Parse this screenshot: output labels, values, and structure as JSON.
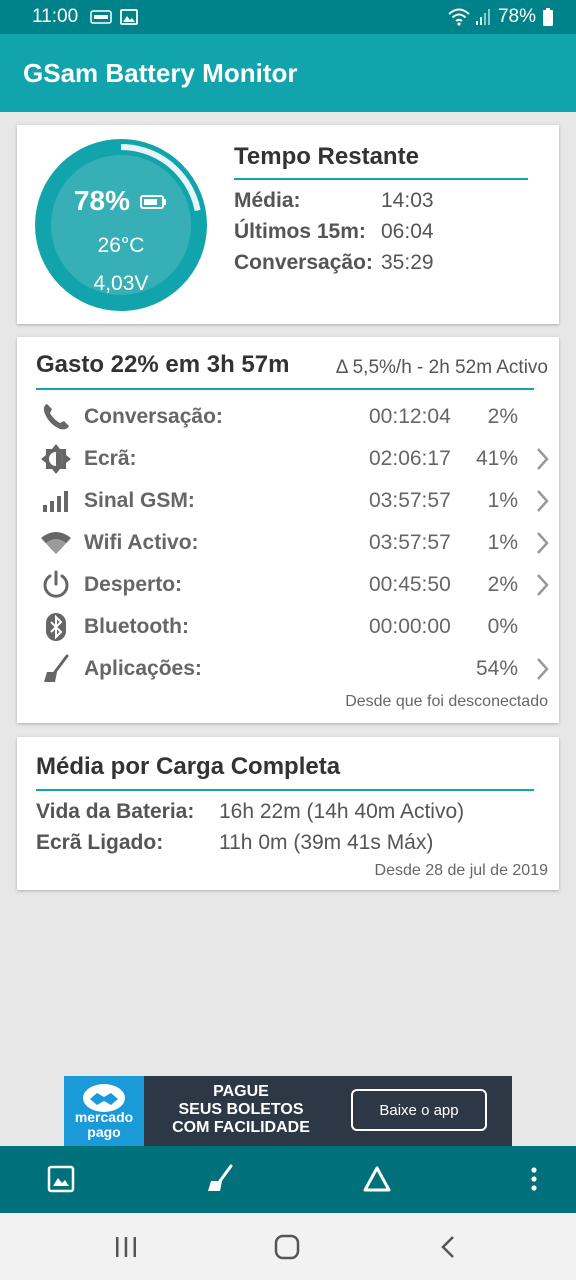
{
  "status_bar": {
    "time": "11:00",
    "battery": "78%"
  },
  "app_bar": {
    "title": "GSam Battery Monitor"
  },
  "battery_card": {
    "percent": "78%",
    "level_fraction": 0.78,
    "temperature": "26°C",
    "voltage": "4,03V",
    "remaining_title": "Tempo Restante",
    "rows": [
      {
        "label": "Média:",
        "value": "14:03"
      },
      {
        "label": "Últimos 15m:",
        "value": "06:04"
      },
      {
        "label": "Conversação:",
        "value": "35:29"
      }
    ]
  },
  "usage_card": {
    "title": "Gasto 22% em 3h 57m",
    "rate": "Δ 5,5%/h - 2h 52m Activo",
    "items": [
      {
        "icon": "phone-icon",
        "label": "Conversação:",
        "time": "00:12:04",
        "percent": "2%",
        "has_chevron": false
      },
      {
        "icon": "brightness-icon",
        "label": "Ecrã:",
        "time": "02:06:17",
        "percent": "41%",
        "has_chevron": true
      },
      {
        "icon": "signal-icon",
        "label": "Sinal GSM:",
        "time": "03:57:57",
        "percent": "1%",
        "has_chevron": true
      },
      {
        "icon": "wifi-icon",
        "label": "Wifi Activo:",
        "time": "03:57:57",
        "percent": "1%",
        "has_chevron": true
      },
      {
        "icon": "power-icon",
        "label": "Desperto:",
        "time": "00:45:50",
        "percent": "2%",
        "has_chevron": true
      },
      {
        "icon": "bluetooth-icon",
        "label": "Bluetooth:",
        "time": "00:00:00",
        "percent": "0%",
        "has_chevron": false
      },
      {
        "icon": "broom-icon",
        "label": "Aplicações:",
        "time": "",
        "percent": "54%",
        "has_chevron": true
      }
    ],
    "footer": "Desde que foi desconectado"
  },
  "average_card": {
    "title": "Média por Carga Completa",
    "rows": [
      {
        "label": "Vida da Bateria:",
        "value": "16h 22m (14h 40m Activo)"
      },
      {
        "label": "Ecrã Ligado:",
        "value": "11h 0m (39m 41s Máx)"
      }
    ],
    "footer": "Desde 28 de jul de 2019"
  },
  "ad": {
    "brand_line1": "mercado",
    "brand_line2": "pago",
    "headline_line1": "PAGUE",
    "headline_line2": "SEUS BOLETOS",
    "headline_line3": "COM FACILIDADE",
    "button": "Baixe o app"
  },
  "toolbar": {
    "icons": [
      "image-icon",
      "broom-icon",
      "triangle-icon",
      "more-vert-icon"
    ]
  },
  "nav_bar": {
    "icons": [
      "recent-apps-icon",
      "home-icon",
      "back-icon"
    ]
  },
  "colors": {
    "accent": "#12a4ad",
    "dark_accent": "#00707a",
    "status_bar": "#00828a"
  }
}
